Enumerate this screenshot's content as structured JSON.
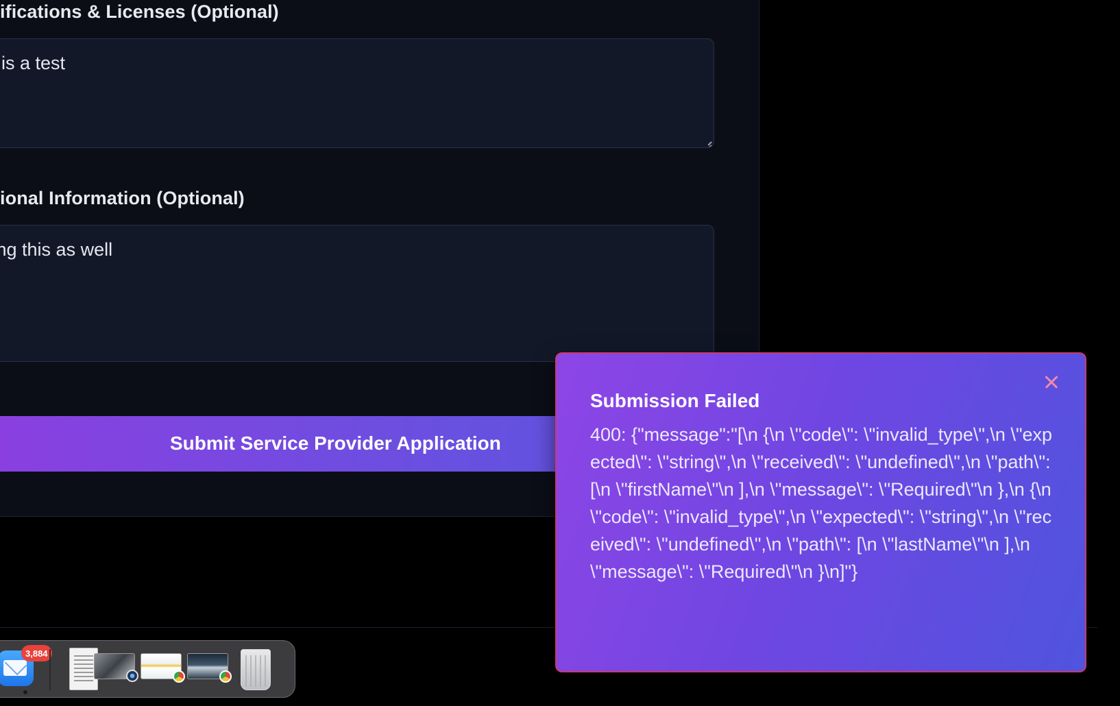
{
  "form": {
    "certifications_label": "ifications & Licenses (Optional)",
    "certifications_value": "s is a test",
    "additional_info_label": "ional Information (Optional)",
    "additional_info_value": "ting this as well",
    "submit_label": "Submit Service Provider Application"
  },
  "toast": {
    "title": "Submission Failed",
    "message": "400: {\"message\":\"[\\n {\\n \\\"code\\\": \\\"invalid_type\\\",\\n \\\"expected\\\": \\\"string\\\",\\n \\\"received\\\": \\\"undefined\\\",\\n \\\"path\\\": [\\n \\\"firstName\\\"\\n ],\\n \\\"message\\\": \\\"Required\\\"\\n },\\n {\\n \\\"code\\\": \\\"invalid_type\\\",\\n \\\"expected\\\": \\\"string\\\",\\n \\\"received\\\": \\\"undefined\\\",\\n \\\"path\\\": [\\n \\\"lastName\\\"\\n ],\\n \\\"message\\\": \\\"Required\\\"\\n }\\n]\"}",
    "close_icon": "close-icon",
    "colors": {
      "gradient_start": "#8e45e6",
      "gradient_end": "#4f54de",
      "border": "#c73a6e"
    }
  },
  "dock": {
    "mail_badge": "3,884",
    "items": [
      "mail-icon",
      "document-icon",
      "preview-thumbnail",
      "chrome-thumbnail",
      "chrome-thumbnail",
      "trash-icon"
    ]
  },
  "colors": {
    "background": "#000000",
    "card": "#0b0e17",
    "textarea": "#131829",
    "button_gradient_start": "#8b3fe0",
    "button_gradient_end": "#5a55de"
  }
}
